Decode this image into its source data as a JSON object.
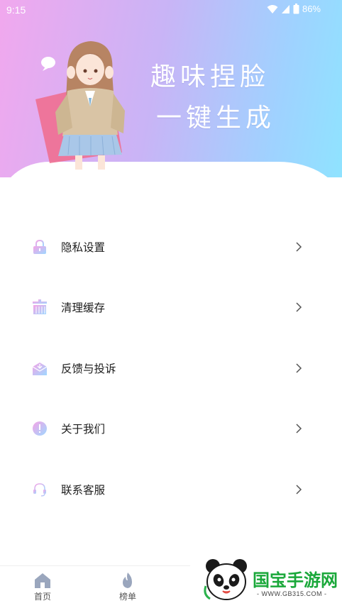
{
  "status_bar": {
    "time": "9:15",
    "battery": "86%"
  },
  "hero": {
    "line1": "趣味捏脸",
    "line2": "一键生成"
  },
  "menu": {
    "items": [
      {
        "label": "隐私设置",
        "icon": "lock-icon"
      },
      {
        "label": "清理缓存",
        "icon": "broom-icon"
      },
      {
        "label": "反馈与投诉",
        "icon": "mail-icon"
      },
      {
        "label": "关于我们",
        "icon": "info-icon"
      },
      {
        "label": "联系客服",
        "icon": "headset-icon"
      }
    ]
  },
  "nav": {
    "items": [
      {
        "label": "首页",
        "icon": "home-icon"
      },
      {
        "label": "榜单",
        "icon": "flame-icon"
      }
    ]
  },
  "watermark": {
    "name": "国宝手游网",
    "url": "- WWW.GB315.COM -"
  },
  "colors": {
    "gradient_start": "#f1a8ee",
    "gradient_end": "#8fe3ff",
    "icon_gradient_a": "#f5a3e6",
    "icon_gradient_b": "#9fd8ff",
    "nav_icon": "#9aa6bd"
  }
}
